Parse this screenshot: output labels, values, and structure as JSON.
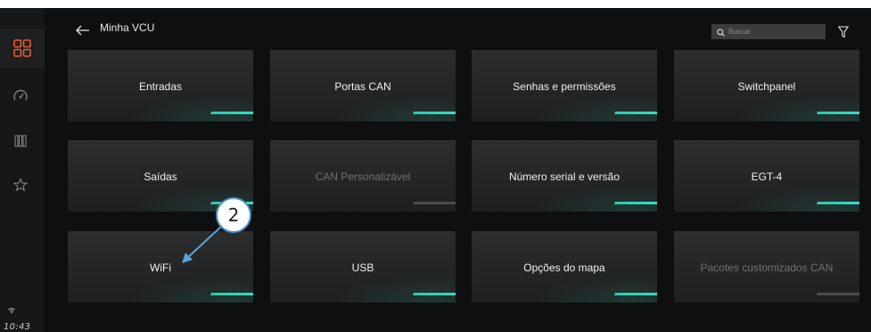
{
  "header": {
    "title": "Minha VCU",
    "back_icon": "arrow-left-icon",
    "search_placeholder": "Buscar",
    "filter_icon": "filter-icon"
  },
  "sidebar": {
    "items": [
      {
        "icon": "apps-grid-icon",
        "active": true
      },
      {
        "icon": "gauge-icon",
        "active": false
      },
      {
        "icon": "columns-icon",
        "active": false
      },
      {
        "icon": "star-icon",
        "active": false
      }
    ],
    "status_icon": "wifi-icon",
    "clock": "10:43"
  },
  "cards": [
    {
      "label": "Entradas",
      "enabled": true
    },
    {
      "label": "Portas CAN",
      "enabled": true
    },
    {
      "label": "Senhas e permissões",
      "enabled": true
    },
    {
      "label": "Switchpanel",
      "enabled": true
    },
    {
      "label": "Saídas",
      "enabled": true
    },
    {
      "label": "CAN Personalizável",
      "enabled": false
    },
    {
      "label": "Número serial e versão",
      "enabled": true
    },
    {
      "label": "EGT-4",
      "enabled": true
    },
    {
      "label": "WiFi",
      "enabled": true
    },
    {
      "label": "USB",
      "enabled": true
    },
    {
      "label": "Opções do mapa",
      "enabled": true
    },
    {
      "label": "Pacotes customizados CAN",
      "enabled": false
    }
  ],
  "callout": {
    "number": "2"
  },
  "colors": {
    "accent": "#2fc7a5",
    "sidebar_active": "#ef5b2c",
    "background": "#0e0f10",
    "card": "#2c2d2e",
    "callout_border": "#4a90c8"
  }
}
